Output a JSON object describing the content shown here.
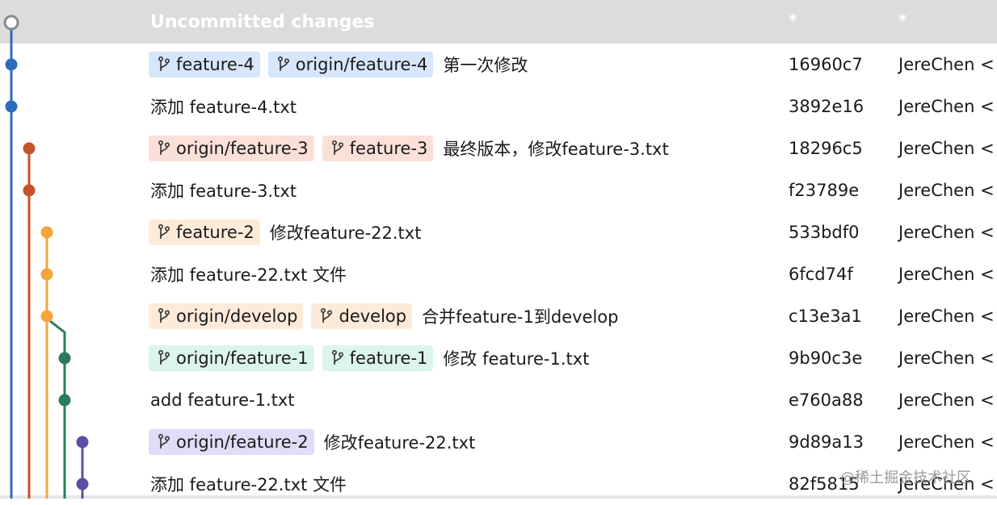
{
  "header": {
    "message": "Uncommitted changes",
    "hash": "*",
    "author": "*"
  },
  "colors": {
    "develop": "#f2a63c",
    "feature_1": "#2d7a5a",
    "feature_2": "#5b4fa3",
    "feature_3": "#c4522a",
    "feature_4": "#2c6bbf",
    "tag_blue": "#d6e6fb",
    "tag_red": "#fbe0d8",
    "tag_orange": "#fdebd9",
    "tag_green": "#dcf5ea",
    "tag_purple": "#e1dcf7"
  },
  "commits": [
    {
      "tags": [
        {
          "label": "feature-4",
          "color": "#d6e6fb"
        },
        {
          "label": "origin/feature-4",
          "color": "#d6e6fb"
        }
      ],
      "message": "第一次修改",
      "hash": "16960c7",
      "author": "JereChen <"
    },
    {
      "tags": [],
      "message": "添加 feature-4.txt",
      "hash": "3892e16",
      "author": "JereChen <"
    },
    {
      "tags": [
        {
          "label": "origin/feature-3",
          "color": "#fbe0d8"
        },
        {
          "label": "feature-3",
          "color": "#fbe0d8"
        }
      ],
      "message": "最终版本，修改feature-3.txt",
      "hash": "18296c5",
      "author": "JereChen <"
    },
    {
      "tags": [],
      "message": "添加 feature-3.txt",
      "hash": "f23789e",
      "author": "JereChen <"
    },
    {
      "tags": [
        {
          "label": "feature-2",
          "color": "#fdebd9"
        }
      ],
      "message": "修改feature-22.txt",
      "hash": "533bdf0",
      "author": "JereChen <"
    },
    {
      "tags": [],
      "message": "添加 feature-22.txt 文件",
      "hash": "6fcd74f",
      "author": "JereChen <"
    },
    {
      "tags": [
        {
          "label": "origin/develop",
          "color": "#fdebd9"
        },
        {
          "label": "develop",
          "color": "#fdebd9"
        }
      ],
      "message": "合并feature-1到develop",
      "hash": "c13e3a1",
      "author": "JereChen <"
    },
    {
      "tags": [
        {
          "label": "origin/feature-1",
          "color": "#dcf5ea"
        },
        {
          "label": "feature-1",
          "color": "#dcf5ea"
        }
      ],
      "message": "修改 feature-1.txt",
      "hash": "9b90c3e",
      "author": "JereChen <"
    },
    {
      "tags": [],
      "message": "add feature-1.txt",
      "hash": "e760a88",
      "author": "JereChen <"
    },
    {
      "tags": [
        {
          "label": "origin/feature-2",
          "color": "#e1dcf7"
        }
      ],
      "message": "修改feature-22.txt",
      "hash": "9d89a13",
      "author": "JereChen <"
    },
    {
      "tags": [],
      "message": "添加 feature-22.txt 文件",
      "hash": "82f5815",
      "author": "JereChen <"
    }
  ],
  "icons": {
    "branch": "branch-icon",
    "uncommitted": "uncommitted-node-icon"
  },
  "watermark": "@稀土掘金技术社区"
}
